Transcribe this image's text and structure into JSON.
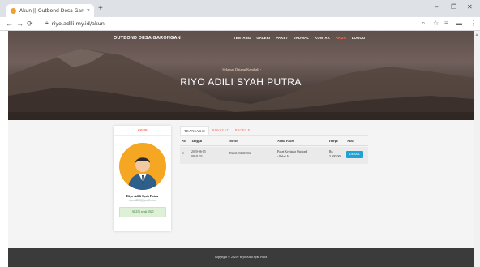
{
  "browser": {
    "tab_title": "Akun || Outbond Desa Garongan",
    "tab_close": "×",
    "new_tab": "+",
    "url": "riyo.adili.my.id/akun",
    "window_controls": [
      "–",
      "❐",
      "✕"
    ]
  },
  "site": {
    "brand": "OUTBOND DESA GARONGAN",
    "menu": [
      {
        "label": "TENTANG",
        "active": false
      },
      {
        "label": "GALERI",
        "active": false
      },
      {
        "label": "PAKET",
        "active": false
      },
      {
        "label": "JADWAL",
        "active": false
      },
      {
        "label": "KONTAK",
        "active": false
      },
      {
        "label": "AKUN",
        "active": true
      },
      {
        "label": "LOGOUT",
        "active": false
      }
    ],
    "colors": {
      "accent": "#ff6a5a",
      "button": "#1fa3d6",
      "footer": "#3b3b3b"
    }
  },
  "hero": {
    "welcome": "- Selamat Datang Kembali -",
    "name": "RIYO ADILI SYAH PUTRA"
  },
  "profile": {
    "header": "AKUN",
    "name": "Riyo Adili Syah Putra",
    "email": "riyoadili3@gmail.com",
    "since": "AKUN sejak 2020"
  },
  "tabs": [
    {
      "label": "TRANSAKSI",
      "active": true
    },
    {
      "label": "RIWAYAT",
      "active": false
    },
    {
      "label": "PROFILE",
      "active": false
    }
  ],
  "table": {
    "headers": [
      "No.",
      "Tanggal",
      "Invoice",
      "Nama Paket",
      "Harga",
      "Aksi"
    ],
    "rows": [
      {
        "no": "1",
        "tanggal_1": "2020-06-15",
        "tanggal_2": "09:41:33",
        "invoice": "TK231592683002",
        "paket_1": "Paket Kegiatan Outbond",
        "paket_2": "- Paket A",
        "harga_1": "Rp.",
        "harga_2": "3.000.000",
        "aksi": "DETAIL"
      }
    ]
  },
  "footer": {
    "text": "Copyright © 2020 - Riyo Adili Syah Putra"
  }
}
